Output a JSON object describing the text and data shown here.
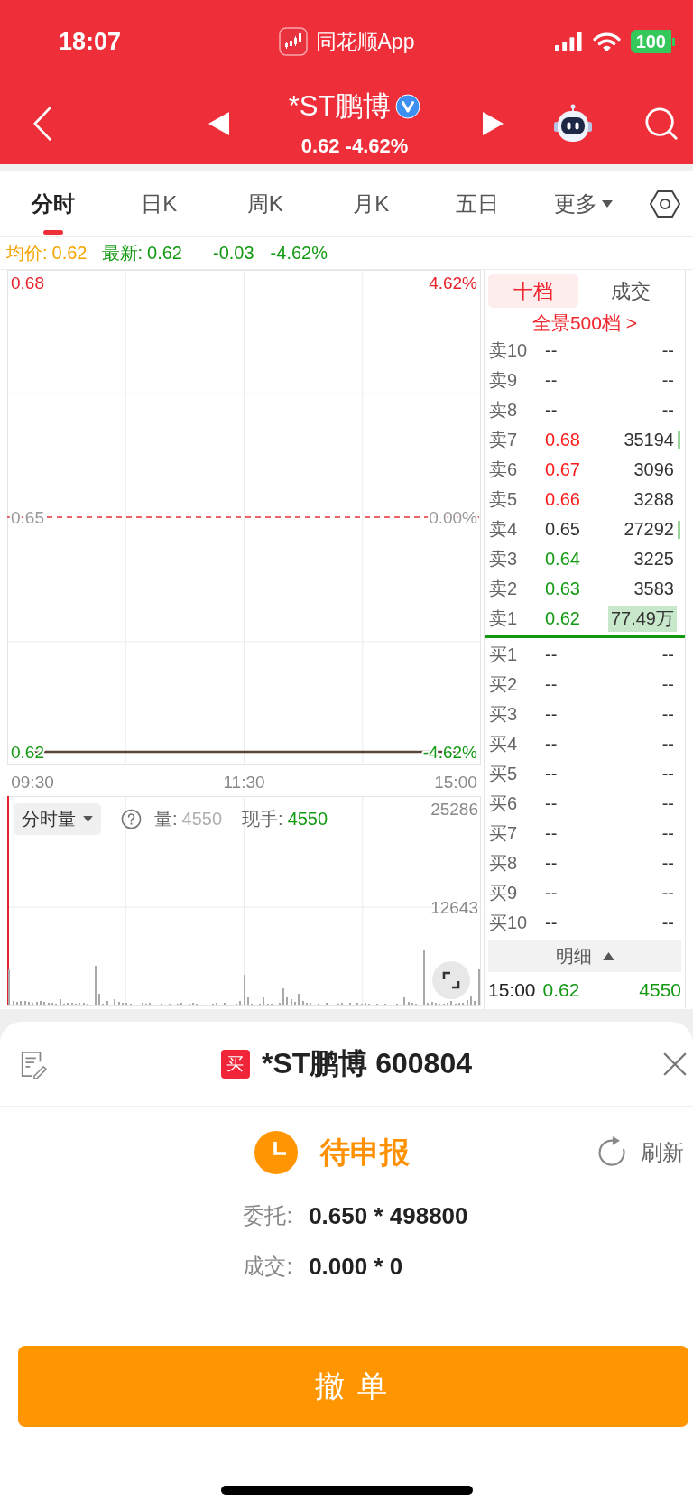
{
  "status_bar": {
    "time": "18:07",
    "app_name": "同花顺App",
    "battery": "100"
  },
  "nav": {
    "title": "*ST鹏博",
    "verified": true,
    "quote": "0.62 -4.62%"
  },
  "tabs": [
    {
      "label": "分时",
      "selected": true,
      "kind": "tab"
    },
    {
      "label": "日K",
      "selected": false,
      "kind": "tab"
    },
    {
      "label": "周K",
      "selected": false,
      "kind": "tab"
    },
    {
      "label": "月K",
      "selected": false,
      "kind": "tab"
    },
    {
      "label": "五日",
      "selected": false,
      "kind": "tab"
    },
    {
      "label": "更多",
      "selected": false,
      "kind": "dropdown"
    }
  ],
  "quote_line": {
    "avg_label": "均价:",
    "avg_value": "0.62",
    "latest_label": "最新:",
    "latest_price": "0.62",
    "change": "-0.03",
    "change_pct": "-4.62%"
  },
  "price_chart": {
    "right_labels": [
      "4.62%",
      "0.00%",
      "-4.62%"
    ],
    "chart_data": {
      "type": "line",
      "categories": [
        "09:30",
        "11:30",
        "15:00"
      ],
      "values": [
        0.62,
        0.62,
        0.62
      ],
      "ylim": [
        0.6185,
        0.6815
      ],
      "yticks": [
        0.62,
        0.65,
        0.68
      ],
      "ref_lines": [
        {
          "axis": "y",
          "value": 0.65
        }
      ]
    }
  },
  "volume_chart": {
    "selector": "分时量",
    "volume_label": "量:",
    "volume_value": "4550",
    "current_label": "现手:",
    "current_value": "4550",
    "chart_data": {
      "type": "bar",
      "categories": [
        null,
        null,
        null,
        null,
        null,
        null,
        null,
        null,
        null,
        null,
        null,
        null,
        null,
        null,
        null,
        null,
        null,
        null,
        null,
        null,
        null,
        null,
        null,
        null,
        null,
        null,
        null,
        null,
        null,
        null,
        null,
        null,
        null,
        null,
        null,
        null,
        null,
        null,
        null,
        null,
        null,
        null,
        null,
        null,
        null,
        null,
        null,
        null,
        null,
        null,
        null,
        null,
        null,
        null,
        null,
        null,
        null,
        null,
        null,
        null,
        null,
        null,
        null,
        null,
        null,
        null,
        null,
        null,
        null,
        null,
        null,
        null,
        null,
        null,
        null,
        null,
        null,
        null,
        null,
        null,
        null,
        null,
        null,
        null,
        null,
        null,
        null,
        null,
        null,
        null,
        null,
        null,
        null,
        null,
        null,
        null,
        null,
        null,
        null,
        null,
        null,
        null,
        null,
        null,
        null,
        null,
        null,
        null,
        null,
        null,
        null,
        null,
        null,
        null,
        null,
        null,
        null,
        null,
        null,
        null,
        null
      ],
      "values": [
        4600,
        600,
        500,
        600,
        600,
        500,
        400,
        500,
        600,
        500,
        400,
        300,
        200,
        800,
        200,
        300,
        400,
        200,
        300,
        300,
        200,
        null,
        5100,
        1500,
        200,
        600,
        null,
        800,
        500,
        300,
        400,
        200,
        null,
        null,
        300,
        200,
        400,
        null,
        null,
        200,
        null,
        200,
        null,
        200,
        300,
        null,
        200,
        300,
        200,
        null,
        null,
        null,
        200,
        300,
        null,
        400,
        null,
        null,
        200,
        600,
        4000,
        1000,
        200,
        null,
        200,
        1000,
        200,
        200,
        null,
        300,
        2200,
        1100,
        800,
        500,
        1500,
        600,
        400,
        300,
        null,
        200,
        null,
        300,
        null,
        null,
        200,
        400,
        null,
        400,
        null,
        400,
        200,
        300,
        200,
        null,
        200,
        null,
        200,
        null,
        null,
        200,
        null,
        1000,
        500,
        400,
        200,
        null,
        7100,
        300,
        500,
        300,
        200,
        200,
        300,
        600,
        200,
        300,
        400,
        700,
        1200,
        600,
        4600
      ],
      "ylim": [
        0,
        26600
      ],
      "yticks": [
        12643,
        25286
      ]
    }
  },
  "order_book": {
    "tabs": [
      {
        "label": "十档",
        "selected": true
      },
      {
        "label": "成交",
        "selected": false
      }
    ],
    "depth_link": "全景500档 >",
    "asks": [
      {
        "label": "卖10",
        "price": "--",
        "volume": "--",
        "color": "#333333",
        "highlighted": false,
        "changed": false
      },
      {
        "label": "卖9",
        "price": "--",
        "volume": "--",
        "color": "#333333",
        "highlighted": false,
        "changed": false
      },
      {
        "label": "卖8",
        "price": "--",
        "volume": "--",
        "color": "#333333",
        "highlighted": false,
        "changed": false
      },
      {
        "label": "卖7",
        "price": "0.68",
        "volume": "35194",
        "color": "#ff1a1a",
        "highlighted": false,
        "changed": true
      },
      {
        "label": "卖6",
        "price": "0.67",
        "volume": "3096",
        "color": "#ff1a1a",
        "highlighted": false,
        "changed": false
      },
      {
        "label": "卖5",
        "price": "0.66",
        "volume": "3288",
        "color": "#ff1a1a",
        "highlighted": false,
        "changed": false
      },
      {
        "label": "卖4",
        "price": "0.65",
        "volume": "27292",
        "color": "#333333",
        "highlighted": false,
        "changed": true
      },
      {
        "label": "卖3",
        "price": "0.64",
        "volume": "3225",
        "color": "#129a12",
        "highlighted": false,
        "changed": false
      },
      {
        "label": "卖2",
        "price": "0.63",
        "volume": "3583",
        "color": "#129a12",
        "highlighted": false,
        "changed": false
      },
      {
        "label": "卖1",
        "price": "0.62",
        "volume": "77.49万",
        "color": "#129a12",
        "highlighted": true,
        "changed": false
      }
    ],
    "bids": [
      {
        "label": "买1",
        "price": "--",
        "volume": "--",
        "color": "#333333",
        "highlighted": false,
        "changed": false
      },
      {
        "label": "买2",
        "price": "--",
        "volume": "--",
        "color": "#333333",
        "highlighted": false,
        "changed": false
      },
      {
        "label": "买3",
        "price": "--",
        "volume": "--",
        "color": "#333333",
        "highlighted": false,
        "changed": false
      },
      {
        "label": "买4",
        "price": "--",
        "volume": "--",
        "color": "#333333",
        "highlighted": false,
        "changed": false
      },
      {
        "label": "买5",
        "price": "--",
        "volume": "--",
        "color": "#333333",
        "highlighted": false,
        "changed": false
      },
      {
        "label": "买6",
        "price": "--",
        "volume": "--",
        "color": "#333333",
        "highlighted": false,
        "changed": false
      },
      {
        "label": "买7",
        "price": "--",
        "volume": "--",
        "color": "#333333",
        "highlighted": false,
        "changed": false
      },
      {
        "label": "买8",
        "price": "--",
        "volume": "--",
        "color": "#333333",
        "highlighted": false,
        "changed": false
      },
      {
        "label": "买9",
        "price": "--",
        "volume": "--",
        "color": "#333333",
        "highlighted": false,
        "changed": false
      },
      {
        "label": "买10",
        "price": "--",
        "volume": "--",
        "color": "#333333",
        "highlighted": false,
        "changed": false
      }
    ],
    "detail_button": "明细",
    "last_trade": {
      "time": "15:00",
      "price": "0.62",
      "volume": "4550"
    }
  },
  "order_sheet": {
    "side": "买",
    "title": "*ST鹏博 600804",
    "status": "待申报",
    "refresh": "刷新",
    "lines": [
      {
        "label": "委托:",
        "value": "0.650 * 498800"
      },
      {
        "label": "成交:",
        "value": "0.000 * 0"
      }
    ],
    "cancel_button": "撤单"
  }
}
